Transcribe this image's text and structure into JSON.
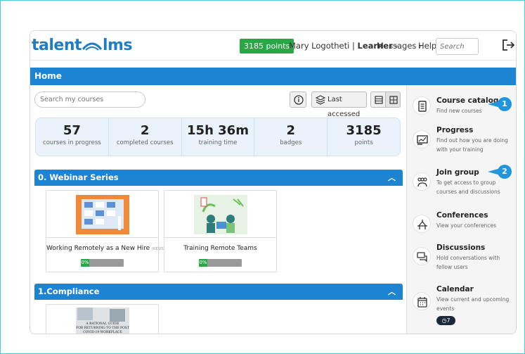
{
  "header": {
    "logo_text_left": "talent",
    "logo_text_right": "lms",
    "points_badge": "3185 points",
    "user_name": "Mary Logotheti",
    "user_separator": "|",
    "user_role": "Learner",
    "messages_label": "Messages",
    "help_label": "Help",
    "search_placeholder": "Search"
  },
  "home_bar": {
    "title": "Home"
  },
  "toolbar": {
    "search_courses_placeholder": "Search my courses",
    "last_accessed_label": "Last accessed"
  },
  "stats": [
    {
      "value": "57",
      "label": "courses in progress"
    },
    {
      "value": "2",
      "label": "completed courses"
    },
    {
      "value": "15h 36m",
      "label": "training time"
    },
    {
      "value": "2",
      "label": "badges"
    },
    {
      "value": "3185",
      "label": "points"
    }
  ],
  "sections": [
    {
      "title": "0. Webinar Series",
      "courses": [
        {
          "title": "Working Remotely as a New Hire",
          "tag": "(REVIST)",
          "progress_label": "0%",
          "progress": 0
        },
        {
          "title": "Training Remote Teams",
          "tag": "",
          "progress_label": "0%",
          "progress": 0
        }
      ]
    },
    {
      "title": "1.Compliance",
      "courses": [
        {
          "thumb_text": "A Rational Guide For Returning to the Post COVID-19 Workplace"
        }
      ]
    }
  ],
  "sidebar": {
    "items": [
      {
        "title": "Course catalog",
        "desc": "Find new courses",
        "icon": "book-icon"
      },
      {
        "title": "Progress",
        "desc": "Find out how you are doing with your training",
        "icon": "chart-icon"
      },
      {
        "title": "Join group",
        "desc": "To get access to group courses and discussions",
        "icon": "group-icon"
      },
      {
        "title": "Conferences",
        "desc": "View your conferences",
        "icon": "presentation-icon"
      },
      {
        "title": "Discussions",
        "desc": "Hold conversations with fellow users",
        "icon": "chat-icon"
      },
      {
        "title": "Calendar",
        "desc": "View current and upcoming events",
        "icon": "calendar-icon",
        "badge": "7"
      }
    ]
  },
  "callouts": [
    "1",
    "2"
  ],
  "colors": {
    "brand_blue": "#1c84d3",
    "points_green": "#28a745",
    "callout_blue": "#2196e0",
    "frame_border": "#4ecbd6"
  }
}
